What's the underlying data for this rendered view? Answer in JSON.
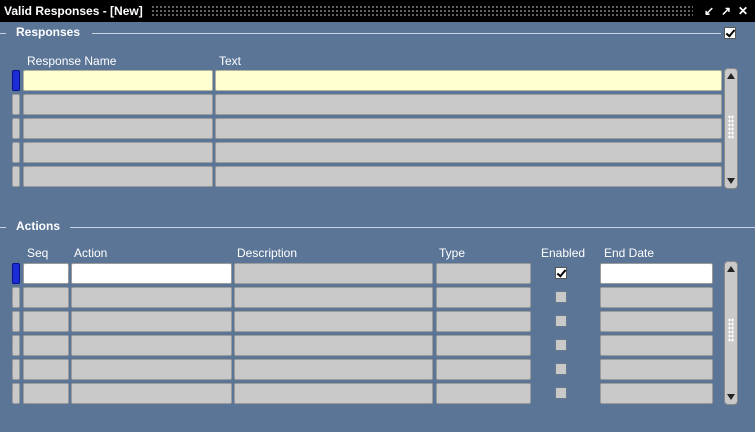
{
  "window": {
    "title": "Valid Responses - [New]",
    "buttons": [
      "minimize-icon",
      "maximize-icon",
      "close-icon"
    ]
  },
  "responses": {
    "section_label": "Responses",
    "checkbox_checked": true,
    "columns": [
      "Response Name",
      "Text"
    ],
    "rows": [
      {
        "name": "",
        "text": ""
      },
      {
        "name": "",
        "text": ""
      },
      {
        "name": "",
        "text": ""
      },
      {
        "name": "",
        "text": ""
      },
      {
        "name": "",
        "text": ""
      }
    ]
  },
  "actions": {
    "section_label": "Actions",
    "columns": [
      "Seq",
      "Action",
      "Description",
      "Type",
      "Enabled",
      "End Date"
    ],
    "rows": [
      {
        "seq": "",
        "action": "",
        "description": "",
        "type": "",
        "enabled": true,
        "end_date": ""
      },
      {
        "seq": "",
        "action": "",
        "description": "",
        "type": "",
        "enabled": false,
        "end_date": ""
      },
      {
        "seq": "",
        "action": "",
        "description": "",
        "type": "",
        "enabled": false,
        "end_date": ""
      },
      {
        "seq": "",
        "action": "",
        "description": "",
        "type": "",
        "enabled": false,
        "end_date": ""
      },
      {
        "seq": "",
        "action": "",
        "description": "",
        "type": "",
        "enabled": false,
        "end_date": ""
      },
      {
        "seq": "",
        "action": "",
        "description": "",
        "type": "",
        "enabled": false,
        "end_date": ""
      }
    ]
  }
}
